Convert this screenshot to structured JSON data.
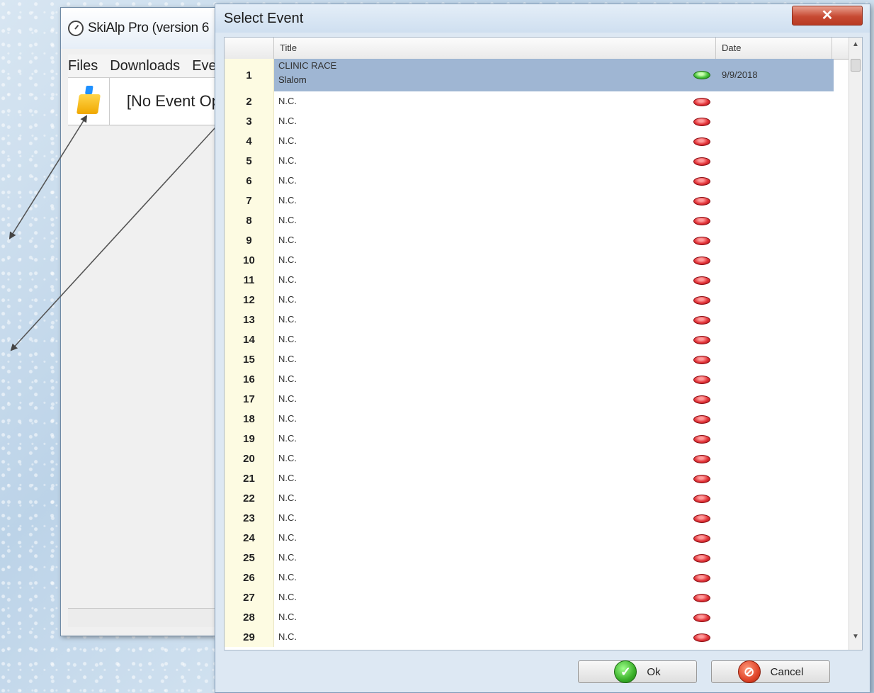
{
  "main_window": {
    "title": "SkiAlp Pro (version 6",
    "menu": [
      "Files",
      "Downloads",
      "Eve"
    ],
    "toolbar_label": "[No Event Op",
    "open_icon": "folder-open-icon"
  },
  "dialog": {
    "title": "Select Event",
    "close_label": "✕",
    "columns": {
      "number": "",
      "title": "Title",
      "date": "Date"
    },
    "rows": [
      {
        "num": "1",
        "title": "CLINIC RACE",
        "subtitle": "Slalom",
        "status": "green",
        "date": "9/9/2018"
      },
      {
        "num": "2",
        "title": "N.C.",
        "status": "red",
        "date": ""
      },
      {
        "num": "3",
        "title": "N.C.",
        "status": "red",
        "date": ""
      },
      {
        "num": "4",
        "title": "N.C.",
        "status": "red",
        "date": ""
      },
      {
        "num": "5",
        "title": "N.C.",
        "status": "red",
        "date": ""
      },
      {
        "num": "6",
        "title": "N.C.",
        "status": "red",
        "date": ""
      },
      {
        "num": "7",
        "title": "N.C.",
        "status": "red",
        "date": ""
      },
      {
        "num": "8",
        "title": "N.C.",
        "status": "red",
        "date": ""
      },
      {
        "num": "9",
        "title": "N.C.",
        "status": "red",
        "date": ""
      },
      {
        "num": "10",
        "title": "N.C.",
        "status": "red",
        "date": ""
      },
      {
        "num": "11",
        "title": "N.C.",
        "status": "red",
        "date": ""
      },
      {
        "num": "12",
        "title": "N.C.",
        "status": "red",
        "date": ""
      },
      {
        "num": "13",
        "title": "N.C.",
        "status": "red",
        "date": ""
      },
      {
        "num": "14",
        "title": "N.C.",
        "status": "red",
        "date": ""
      },
      {
        "num": "15",
        "title": "N.C.",
        "status": "red",
        "date": ""
      },
      {
        "num": "16",
        "title": "N.C.",
        "status": "red",
        "date": ""
      },
      {
        "num": "17",
        "title": "N.C.",
        "status": "red",
        "date": ""
      },
      {
        "num": "18",
        "title": "N.C.",
        "status": "red",
        "date": ""
      },
      {
        "num": "19",
        "title": "N.C.",
        "status": "red",
        "date": ""
      },
      {
        "num": "20",
        "title": "N.C.",
        "status": "red",
        "date": ""
      },
      {
        "num": "21",
        "title": "N.C.",
        "status": "red",
        "date": ""
      },
      {
        "num": "22",
        "title": "N.C.",
        "status": "red",
        "date": ""
      },
      {
        "num": "23",
        "title": "N.C.",
        "status": "red",
        "date": ""
      },
      {
        "num": "24",
        "title": "N.C.",
        "status": "red",
        "date": ""
      },
      {
        "num": "25",
        "title": "N.C.",
        "status": "red",
        "date": ""
      },
      {
        "num": "26",
        "title": "N.C.",
        "status": "red",
        "date": ""
      },
      {
        "num": "27",
        "title": "N.C.",
        "status": "red",
        "date": ""
      },
      {
        "num": "28",
        "title": "N.C.",
        "status": "red",
        "date": ""
      },
      {
        "num": "29",
        "title": "N.C.",
        "status": "red",
        "date": ""
      }
    ],
    "buttons": {
      "ok": "Ok",
      "cancel": "Cancel"
    },
    "colors": {
      "selected_row": "#9fb6d3",
      "number_column": "#fdfbe2",
      "status_ok": "#46c23a",
      "status_empty": "#e3353a"
    }
  }
}
